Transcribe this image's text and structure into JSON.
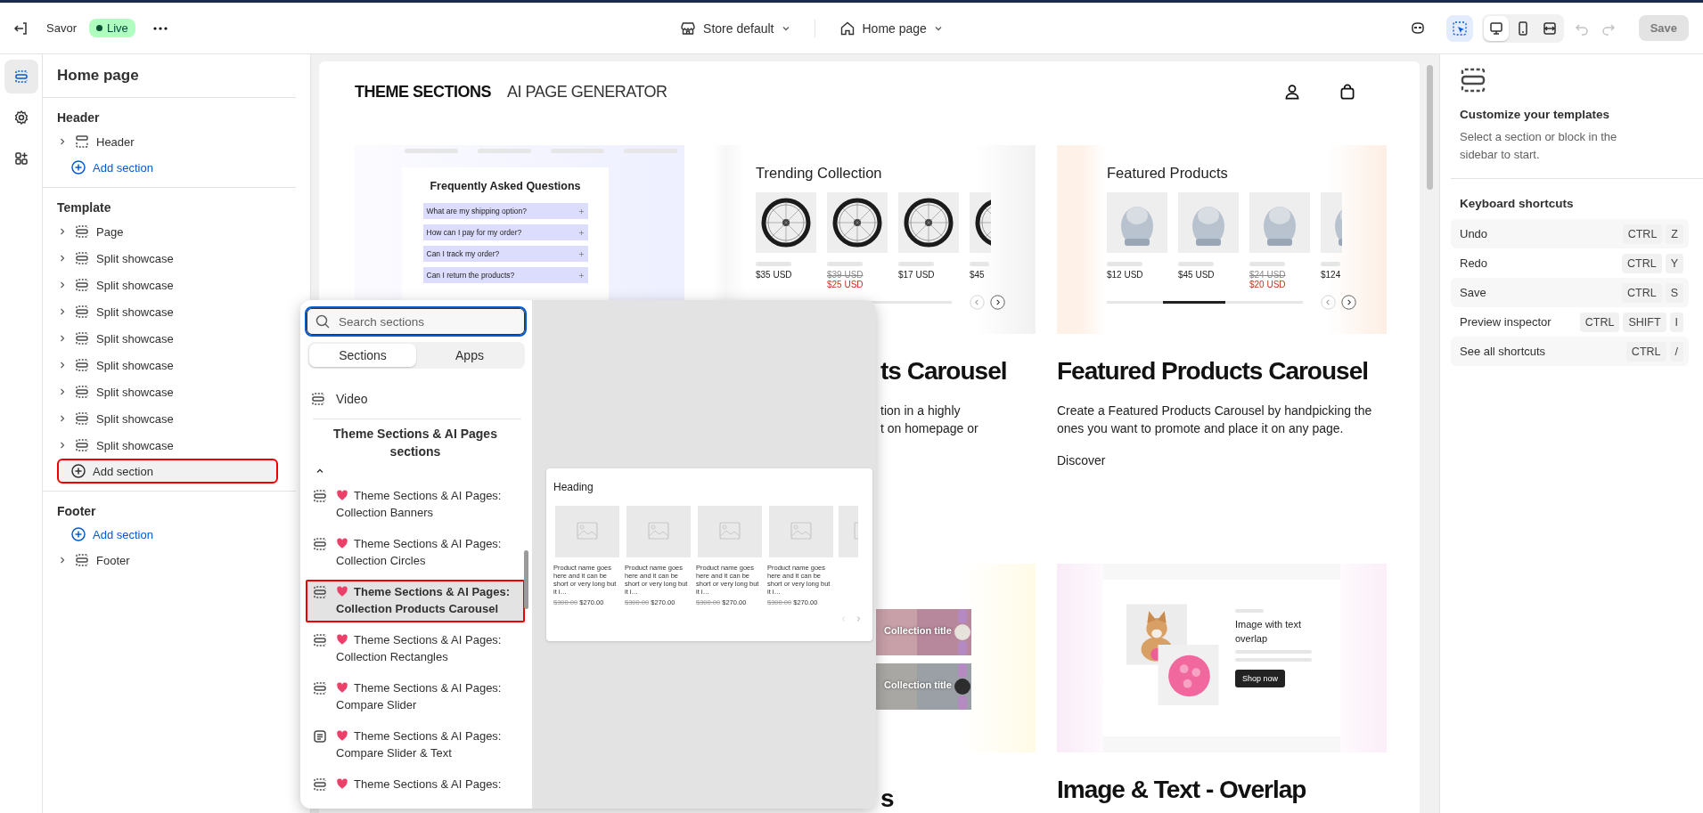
{
  "topbar": {
    "store_name": "Savor",
    "status": "Live",
    "store_selector": "Store default",
    "page_selector": "Home page",
    "inspector_on": true,
    "views": [
      {
        "kind": "desktop",
        "selected": true
      },
      {
        "kind": "mobile",
        "selected": false
      },
      {
        "kind": "full",
        "selected": false
      }
    ],
    "undo_disabled": true,
    "redo_disabled": true,
    "save": {
      "label": "Save",
      "disabled": true
    }
  },
  "rail": [
    {
      "kind": "sections",
      "selected": true
    },
    {
      "kind": "settings",
      "selected": false
    },
    {
      "kind": "apps",
      "selected": false
    }
  ],
  "sidebar": {
    "title": "Home page",
    "groups": [
      {
        "heading": "Header",
        "items": [
          {
            "kind": "header",
            "label": "Header"
          },
          {
            "kind": "add",
            "label": "Add section",
            "highlighted": false
          }
        ]
      },
      {
        "heading": "Template",
        "items": [
          {
            "kind": "section",
            "label": "Page"
          },
          {
            "kind": "section",
            "label": "Split showcase"
          },
          {
            "kind": "section",
            "label": "Split showcase"
          },
          {
            "kind": "section",
            "label": "Split showcase"
          },
          {
            "kind": "section",
            "label": "Split showcase"
          },
          {
            "kind": "section",
            "label": "Split showcase"
          },
          {
            "kind": "section",
            "label": "Split showcase"
          },
          {
            "kind": "section",
            "label": "Split showcase"
          },
          {
            "kind": "section",
            "label": "Split showcase"
          },
          {
            "kind": "add",
            "label": "Add section",
            "highlighted": true
          }
        ]
      },
      {
        "heading": "Footer",
        "items": [
          {
            "kind": "add",
            "label": "Add section",
            "highlighted": false
          },
          {
            "kind": "section",
            "label": "Footer"
          }
        ]
      }
    ]
  },
  "preview": {
    "logo": "THEME SECTIONS",
    "nav_link": "AI PAGE GENERATOR",
    "cards": [
      {
        "kind": "faq",
        "thumb_title": "Frequently Asked Questions",
        "questions": [
          "What are my shipping option?",
          "How can I pay for my order?",
          "Can I track my order?",
          "Can I return the products?"
        ]
      },
      {
        "kind": "products",
        "thumb_title": "Trending Collection",
        "products": [
          {
            "price": "$35 USD"
          },
          {
            "old_price": "$39 USD",
            "price": "$25 USD"
          },
          {
            "price": "$17 USD"
          },
          {
            "price": "$45"
          }
        ],
        "title": "ts Carousel",
        "description_fragments": [
          "tion in a highly",
          "t on homepage or"
        ]
      },
      {
        "kind": "products",
        "thumb_title": "Featured Products",
        "products": [
          {
            "price": "$12 USD"
          },
          {
            "price": "$45 USD"
          },
          {
            "old_price": "$24 USD",
            "price": "$20 USD"
          },
          {
            "price": "$124"
          }
        ],
        "title": "Featured Products Carousel",
        "description": "Create a Featured Products Carousel by handpicking the ones you want to promote and place it on any page.",
        "link": "Discover"
      },
      {
        "kind": "collections",
        "collections": [
          "Collection title",
          "Collection title"
        ],
        "title": "s"
      },
      {
        "kind": "overlap",
        "thumb_title": "Image with text overlap",
        "button": "Shop now",
        "title": "Image & Text - Overlap"
      }
    ]
  },
  "section_picker": {
    "search_placeholder": "Search sections",
    "tabs": [
      {
        "label": "Sections",
        "selected": true
      },
      {
        "label": "Apps",
        "selected": false
      }
    ],
    "items": [
      {
        "kind": "section",
        "label": "Video"
      }
    ],
    "group": {
      "heading": "Theme Sections & AI Pages sections",
      "expanded": true,
      "items": [
        {
          "kind": "section",
          "label": "Theme Sections & AI Pages: Collection Banners",
          "selected": false
        },
        {
          "kind": "section",
          "label": "Theme Sections & AI Pages: Collection Circles",
          "selected": false
        },
        {
          "kind": "section",
          "label": "Theme Sections & AI Pages: Collection Products Carousel",
          "selected": true
        },
        {
          "kind": "section",
          "label": "Theme Sections & AI Pages: Collection Rectangles",
          "selected": false
        },
        {
          "kind": "section",
          "label": "Theme Sections & AI Pages: Compare Slider",
          "selected": false
        },
        {
          "kind": "text",
          "label": "Theme Sections & AI Pages: Compare Slider & Text",
          "selected": false
        },
        {
          "kind": "section",
          "label": "Theme Sections & AI Pages:",
          "selected": false
        }
      ]
    },
    "preview": {
      "heading": "Heading",
      "products": [
        {
          "name": "Product name goes here and it can be short or very long but it i…",
          "old_price": "$300.00",
          "price": "$270.00"
        },
        {
          "name": "Product name goes here and it can be short or very long but it i…",
          "old_price": "$300.00",
          "price": "$270.00"
        },
        {
          "name": "Product name goes here and it can be short or very long but it i…",
          "old_price": "$300.00",
          "price": "$270.00"
        },
        {
          "name": "Product name goes here and it can be short or very long but it i…",
          "old_price": "$300.00",
          "price": "$270.00"
        }
      ]
    }
  },
  "inspector": {
    "title": "Customize your templates",
    "description": "Select a section or block in the sidebar to start.",
    "shortcuts_title": "Keyboard shortcuts",
    "shortcuts": [
      {
        "action": "Undo",
        "keys": [
          "CTRL",
          "Z"
        ]
      },
      {
        "action": "Redo",
        "keys": [
          "CTRL",
          "Y"
        ]
      },
      {
        "action": "Save",
        "keys": [
          "CTRL",
          "S"
        ]
      },
      {
        "action": "Preview inspector",
        "keys": [
          "CTRL",
          "SHIFT",
          "I"
        ]
      },
      {
        "action": "See all shortcuts",
        "keys": [
          "CTRL",
          "/"
        ]
      }
    ]
  }
}
